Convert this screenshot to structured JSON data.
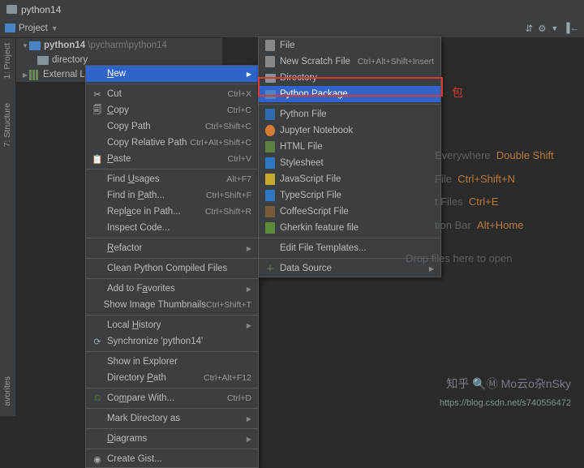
{
  "titlebar": {
    "text": "python14"
  },
  "toolbar": {
    "project_label": "Project"
  },
  "side_tabs": {
    "project": "1: Project",
    "structure": "7: Structure",
    "favorites": "avorites"
  },
  "tree": {
    "root_name": "python14",
    "root_path": "\\pycharm\\python14",
    "dir": "directory",
    "ext_lib": "External Libra"
  },
  "ctx1": {
    "new": "New",
    "cut": "Cut",
    "cut_k": "Ctrl+X",
    "copy": "Copy",
    "copy_k": "Ctrl+C",
    "copy_path": "Copy Path",
    "copy_path_k": "Ctrl+Shift+C",
    "copy_rel": "Copy Relative Path",
    "copy_rel_k": "Ctrl+Alt+Shift+C",
    "paste": "Paste",
    "paste_k": "Ctrl+V",
    "find_usages": "Find Usages",
    "find_usages_k": "Alt+F7",
    "find_in_path": "Find in Path...",
    "find_in_path_k": "Ctrl+Shift+F",
    "replace_in_path": "Replace in Path...",
    "replace_in_path_k": "Ctrl+Shift+R",
    "inspect": "Inspect Code...",
    "refactor": "Refactor",
    "clean_pyc": "Clean Python Compiled Files",
    "add_fav": "Add to Favorites",
    "show_thumbs": "Show Image Thumbnails",
    "show_thumbs_k": "Ctrl+Shift+T",
    "local_hist": "Local History",
    "sync": "Synchronize 'python14'",
    "show_explorer": "Show in Explorer",
    "dir_path": "Directory Path",
    "dir_path_k": "Ctrl+Alt+F12",
    "compare": "Compare With...",
    "compare_k": "Ctrl+D",
    "mark_dir": "Mark Directory as",
    "diagrams": "Diagrams",
    "gist": "Create Gist..."
  },
  "ctx2": {
    "file": "File",
    "scratch": "New Scratch File",
    "scratch_k": "Ctrl+Alt+Shift+Insert",
    "directory": "Directory",
    "py_pkg": "Python Package",
    "py_file": "Python File",
    "jupyter": "Jupyter Notebook",
    "html": "HTML File",
    "stylesheet": "Stylesheet",
    "js": "JavaScript File",
    "ts": "TypeScript File",
    "coffee": "CoffeeScript File",
    "gherkin": "Gherkin feature file",
    "edit_tmpl": "Edit File Templates...",
    "data_src": "Data Source"
  },
  "annotation": "包",
  "hints": {
    "h1a": " Everywhere",
    "h1b": "Double Shift",
    "h2a": " File",
    "h2b": "Ctrl+Shift+N",
    "h3a": "t Files",
    "h3b": "Ctrl+E",
    "h4a": "tion Bar",
    "h4b": "Alt+Home"
  },
  "drop": "Drop files here to open",
  "watermark": "知乎 🔍Ⓜ Mo云o杂nSky",
  "url": "https://blog.csdn.net/s740556472"
}
